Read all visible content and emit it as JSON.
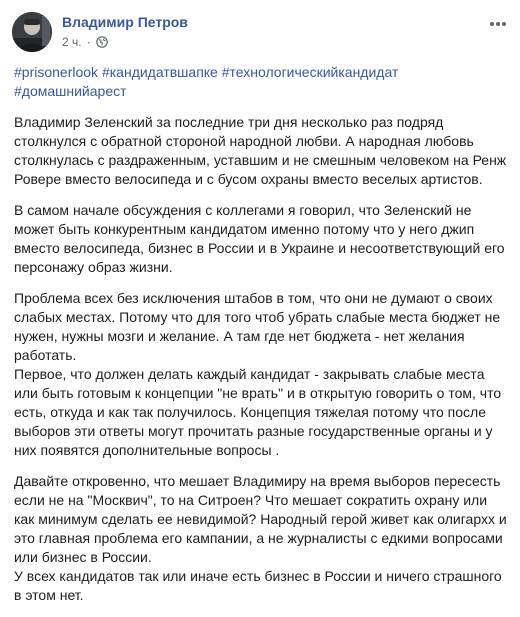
{
  "post": {
    "author": "Владимир Петров",
    "time": "2 ч.",
    "separator": "·",
    "privacy_icon": "globe-icon",
    "more_icon": "more-options-icon",
    "hashtags": [
      "#prisonerlook",
      "#кандидатвшапке",
      "#технологическийкандидат",
      "#домашнийарест"
    ],
    "paragraphs": [
      [
        "Владимир Зеленский за последние три дня несколько раз подряд столкнулся с обратной стороной народной любви. А народная любовь столкнулась с раздраженным, уставшим и не смешным человеком на Ренж Ровере вместо велосипеда и с бусом охраны вместо веселых артистов."
      ],
      [
        "В самом начале обсуждения с коллегами я говорил, что Зеленский не может быть конкурентным кандидатом именно потому что у него джип вместо велосипеда, бизнес в России и в Украине и несоответствующий его персонажу образ жизни."
      ],
      [
        "Проблема всех без исключения штабов в том, что они не думают о своих слабых местах. Потому что для того чтоб убрать слабые места бюджет не нужен, нужны мозги и желание. А там где нет бюджета - нет желания работать.",
        "Первое, что должен делать каждый кандидат - закрывать слабые места или быть готовым к концепции \"не врать\" и в открытую говорить о том, что есть, откуда и как так получилось. Концепция тяжелая потому что после выборов эти ответы могут прочитать разные государственные органы и у них появятся дополнительные вопросы ."
      ],
      [
        "Давайте откровенно, что мешает Владимиру на время выборов пересесть если не на \"Москвич\", то на Ситроен? Что мешает сократить охрану или как минимум сделать ее невидимой? Народный герой живет как олигархх и это главная проблема его кампании, а не журналисты с едкими вопросами или бизнес в России.",
        "У всех кандидатов так или иначе есть бизнес в России и ничего страшного в этом нет."
      ]
    ]
  },
  "colors": {
    "link": "#385898",
    "text": "#1c1e21",
    "meta": "#606770"
  }
}
